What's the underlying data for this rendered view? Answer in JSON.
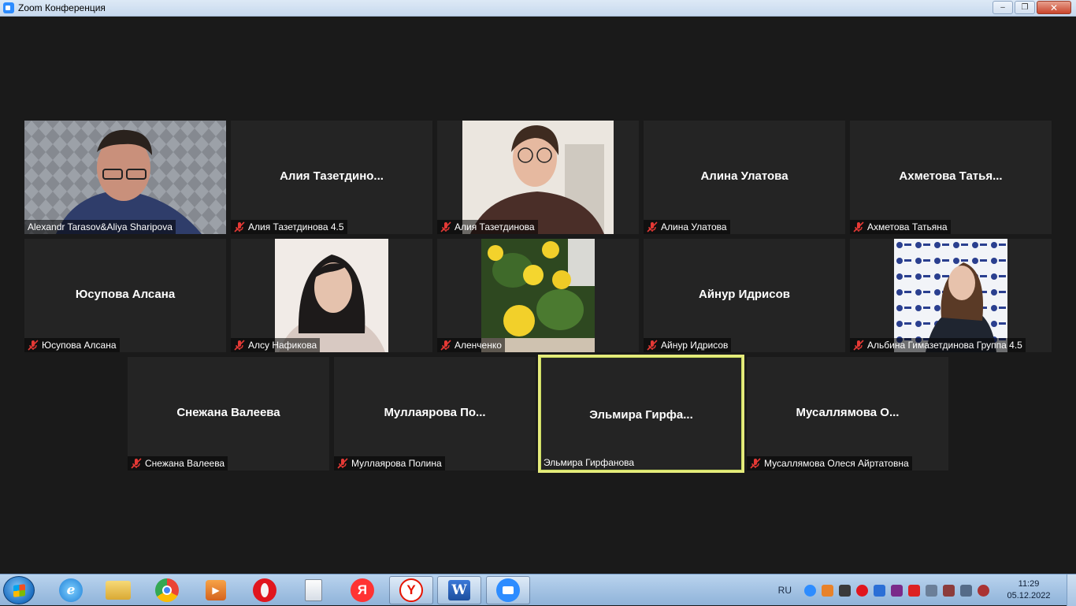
{
  "window": {
    "title": "Zoom Конференция",
    "min": "‒",
    "max": "❐",
    "close": "✕"
  },
  "participants": [
    {
      "id": "p1",
      "label": "Alexandr Tarasov&Aliya Sharipova",
      "muted": false,
      "video": true,
      "speaking": true
    },
    {
      "id": "p2",
      "display": "Алия  Тазетдино...",
      "label": "Алия Тазетдинова 4.5",
      "muted": true
    },
    {
      "id": "p3",
      "label": "Алия Тазетдинова",
      "muted": true,
      "video": true
    },
    {
      "id": "p4",
      "display": "Алина Улатова",
      "label": "Алина Улатова",
      "muted": true
    },
    {
      "id": "p5",
      "display": "Ахметова  Татья...",
      "label": "Ахметова Татьяна",
      "muted": true
    },
    {
      "id": "p6",
      "display": "Юсупова Алсана",
      "label": "Юсупова Алсана",
      "muted": true
    },
    {
      "id": "p7",
      "label": "Алсу Нафикова",
      "muted": true,
      "video": true
    },
    {
      "id": "p8",
      "label": "Аленченко",
      "muted": true,
      "video": true
    },
    {
      "id": "p9",
      "display": "Айнур Идрисов",
      "label": "Айнур Идрисов",
      "muted": true
    },
    {
      "id": "p10",
      "label": "Альбина Гимазетдинова Группа 4.5",
      "muted": true,
      "video": true
    },
    {
      "id": "p11",
      "display": "Снежана Валеева",
      "label": "Снежана Валеева",
      "muted": true
    },
    {
      "id": "p12",
      "display": "Муллаярова  По...",
      "label": "Муллаярова Полина",
      "muted": true
    },
    {
      "id": "p13",
      "display": "Эльмира  Гирфа...",
      "label": "Эльмира Гирфанова",
      "muted": false,
      "active": true
    },
    {
      "id": "p14",
      "display": "Мусаллямова  О...",
      "label": "Мусаллямова Олеся Айртатовна",
      "muted": true
    }
  ],
  "taskbar": {
    "apps": [
      "internet-explorer",
      "file-explorer",
      "chrome",
      "media-player",
      "opera",
      "notepad",
      "yandex",
      "yandex-browser",
      "word",
      "zoom"
    ],
    "word_letter": "W",
    "yandex_letter": "Я",
    "yandex_browser_letter": "Y",
    "tray": {
      "lang": "RU",
      "time": "11:29",
      "date": "05.12.2022"
    }
  },
  "colors": {
    "background": "#1a1a1a",
    "tile": "#242424",
    "active_border": "#e6ec7c",
    "mute_icon": "#e53935"
  }
}
